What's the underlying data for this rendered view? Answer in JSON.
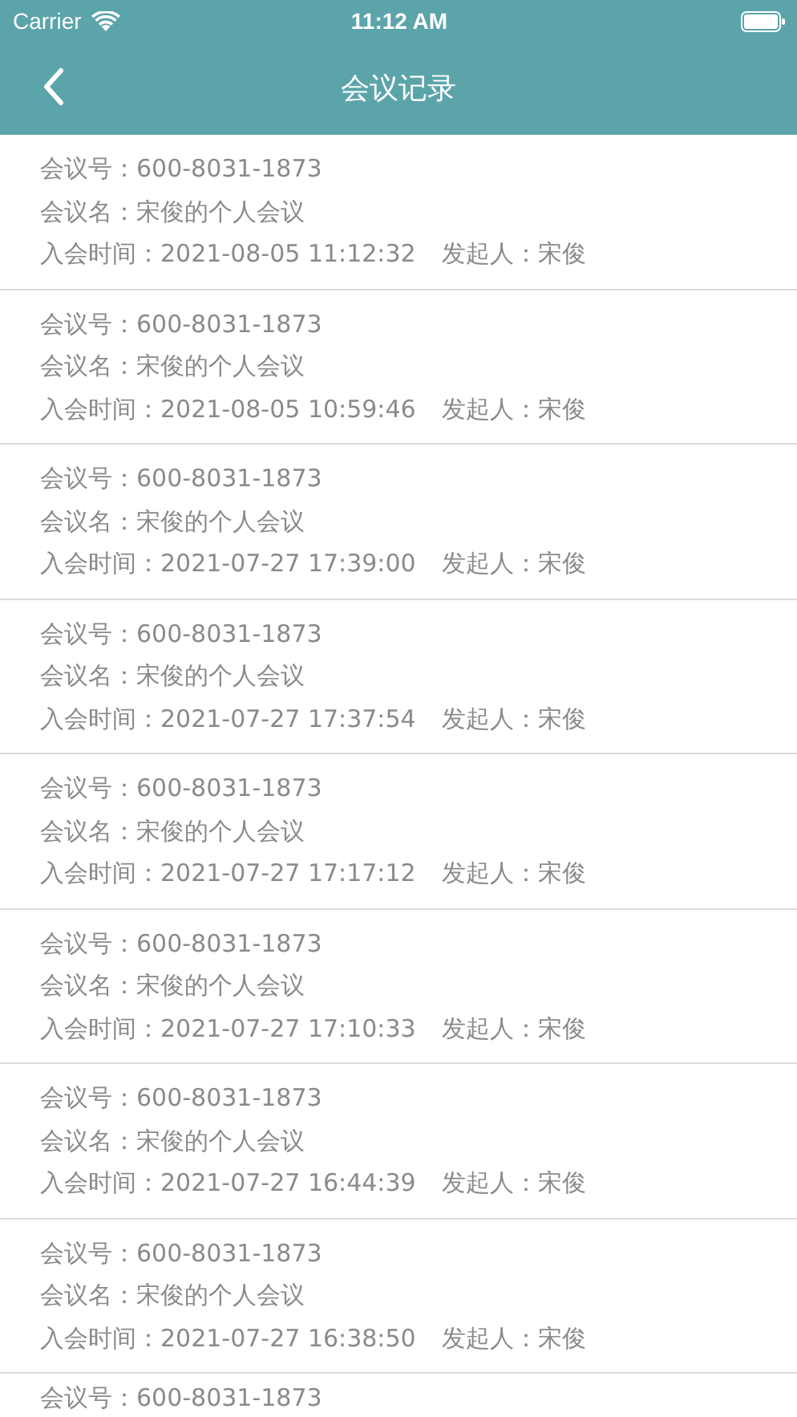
{
  "status_bar": {
    "carrier": "Carrier",
    "time": "11:12 AM"
  },
  "nav_bar": {
    "title": "会议记录"
  },
  "records": [
    {
      "number": "会议号：600-8031-1873",
      "name": "会议名：宋俊的个人会议",
      "join_time": "入会时间：2021-08-05 11:12:32",
      "initiator": "发起人：宋俊"
    },
    {
      "number": "会议号：600-8031-1873",
      "name": "会议名：宋俊的个人会议",
      "join_time": "入会时间：2021-08-05 10:59:46",
      "initiator": "发起人：宋俊"
    },
    {
      "number": "会议号：600-8031-1873",
      "name": "会议名：宋俊的个人会议",
      "join_time": "入会时间：2021-07-27 17:39:00",
      "initiator": "发起人：宋俊"
    },
    {
      "number": "会议号：600-8031-1873",
      "name": "会议名：宋俊的个人会议",
      "join_time": "入会时间：2021-07-27 17:37:54",
      "initiator": "发起人：宋俊"
    },
    {
      "number": "会议号：600-8031-1873",
      "name": "会议名：宋俊的个人会议",
      "join_time": "入会时间：2021-07-27 17:17:12",
      "initiator": "发起人：宋俊"
    },
    {
      "number": "会议号：600-8031-1873",
      "name": "会议名：宋俊的个人会议",
      "join_time": "入会时间：2021-07-27 17:10:33",
      "initiator": "发起人：宋俊"
    },
    {
      "number": "会议号：600-8031-1873",
      "name": "会议名：宋俊的个人会议",
      "join_time": "入会时间：2021-07-27 16:44:39",
      "initiator": "发起人：宋俊"
    },
    {
      "number": "会议号：600-8031-1873",
      "name": "会议名：宋俊的个人会议",
      "join_time": "入会时间：2021-07-27 16:38:50",
      "initiator": "发起人：宋俊"
    },
    {
      "number": "会议号：600-8031-1873"
    }
  ]
}
